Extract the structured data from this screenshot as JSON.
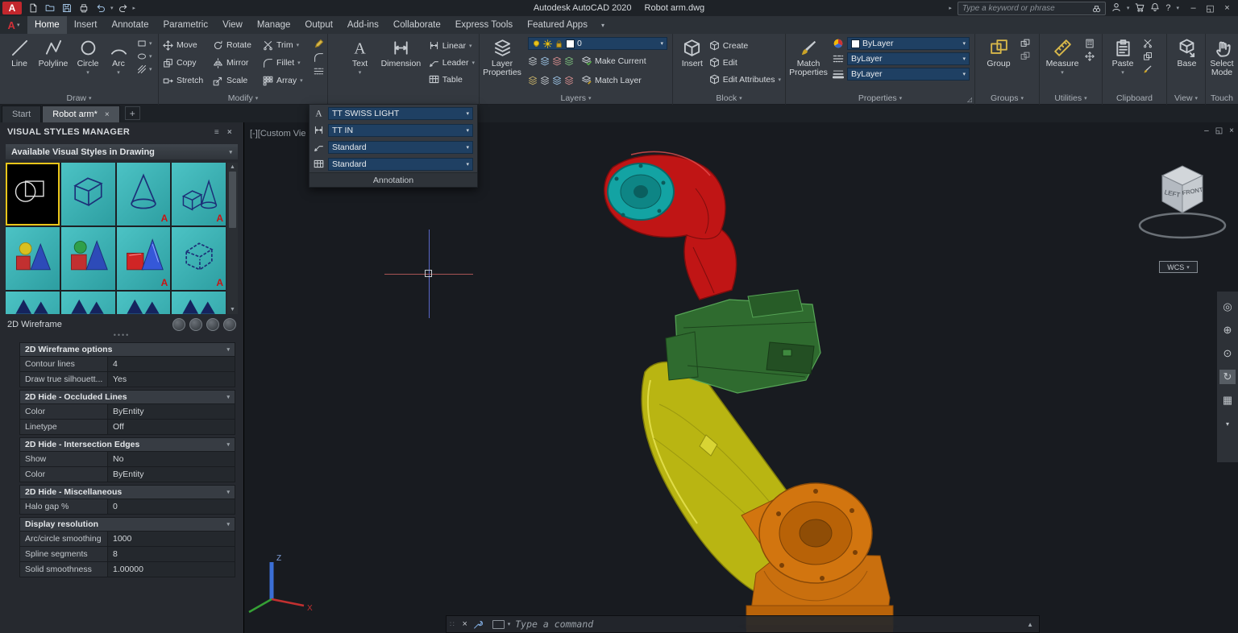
{
  "colors": {
    "accent_red": "#c2272d",
    "selection_yellow": "#e8c51a",
    "combo_blue": "#1f4063",
    "canvas_bg": "#181b20",
    "robot_red": "#c01515",
    "robot_green": "#2f6b2f",
    "robot_yellow": "#b9b512",
    "robot_orange": "#c96f0e",
    "robot_cyan": "#13a3a3"
  },
  "titlebar": {
    "app_title": "Autodesk AutoCAD 2020",
    "doc_title": "Robot arm.dwg",
    "search_placeholder": "Type a keyword or phrase"
  },
  "menu": {
    "active_tab": "Home",
    "tabs": [
      "Home",
      "Insert",
      "Annotate",
      "Parametric",
      "View",
      "Manage",
      "Output",
      "Add-ins",
      "Collaborate",
      "Express Tools",
      "Featured Apps"
    ]
  },
  "ribbon": {
    "draw": {
      "label": "Draw",
      "tools": [
        "Line",
        "Polyline",
        "Circle",
        "Arc"
      ]
    },
    "modify": {
      "label": "Modify",
      "tools": [
        "Move",
        "Rotate",
        "Trim",
        "Copy",
        "Mirror",
        "Fillet",
        "Stretch",
        "Scale",
        "Array"
      ]
    },
    "annotation": {
      "tools": [
        "Text",
        "Dimension",
        "Linear",
        "Leader",
        "Table"
      ]
    },
    "layers": {
      "label": "Layers",
      "big": "Layer Properties",
      "current_layer": "0",
      "make_current": "Make Current",
      "match_layer": "Match Layer"
    },
    "block": {
      "label": "Block",
      "big": "Insert",
      "tools": [
        "Create",
        "Edit",
        "Edit Attributes"
      ]
    },
    "properties": {
      "label": "Properties",
      "big": "Match Properties",
      "object_color": "ByLayer",
      "linetype": "ByLayer",
      "lineweight": "ByLayer"
    },
    "groups": {
      "label": "Groups",
      "big": "Group"
    },
    "utilities": {
      "label": "Utilities",
      "big": "Measure"
    },
    "clipboard": {
      "label": "Clipboard",
      "big": "Paste"
    },
    "view": {
      "label": "View",
      "big": "Base"
    },
    "touch": {
      "label": "Touch",
      "big": "Select Mode"
    }
  },
  "annotation_flyout": {
    "text_style": "TT SWISS LIGHT",
    "dim_style": "TT IN",
    "mleader_style": "Standard",
    "table_style": "Standard",
    "footer": "Annotation"
  },
  "file_tabs": {
    "tabs": [
      "Start",
      "Robot arm*"
    ],
    "active": "Robot arm*"
  },
  "palette": {
    "title": "VISUAL STYLES MANAGER",
    "styles_header": "Available Visual Styles in Drawing",
    "current_style": "2D Wireframe",
    "styles": [
      {
        "kind": "2d-wireframe",
        "selected": true,
        "badge": false
      },
      {
        "kind": "wireframe-box",
        "selected": false,
        "badge": false
      },
      {
        "kind": "hidden-cone",
        "selected": false,
        "badge": true
      },
      {
        "kind": "wireframe-group",
        "selected": false,
        "badge": true
      },
      {
        "kind": "sketchy-solids",
        "selected": false,
        "badge": false
      },
      {
        "kind": "shaded-solids",
        "selected": false,
        "badge": false
      },
      {
        "kind": "realistic-solids",
        "selected": false,
        "badge": true
      },
      {
        "kind": "sketchy-box",
        "selected": false,
        "badge": true
      },
      {
        "kind": "partial",
        "selected": false,
        "badge": false
      },
      {
        "kind": "partial",
        "selected": false,
        "badge": false
      },
      {
        "kind": "partial",
        "selected": false,
        "badge": false
      },
      {
        "kind": "partial",
        "selected": false,
        "badge": false
      }
    ],
    "sections": [
      {
        "title": "2D Wireframe options",
        "rows": [
          {
            "label": "Contour lines",
            "value": "4"
          },
          {
            "label": "Draw true silhouett...",
            "value": "Yes"
          }
        ]
      },
      {
        "title": "2D Hide - Occluded Lines",
        "rows": [
          {
            "label": "Color",
            "value": "ByEntity"
          },
          {
            "label": "Linetype",
            "value": "Off"
          }
        ]
      },
      {
        "title": "2D Hide - Intersection Edges",
        "rows": [
          {
            "label": "Show",
            "value": "No"
          },
          {
            "label": "Color",
            "value": "ByEntity"
          }
        ]
      },
      {
        "title": "2D Hide - Miscellaneous",
        "rows": [
          {
            "label": "Halo gap %",
            "value": "0"
          }
        ]
      },
      {
        "title": "Display resolution",
        "rows": [
          {
            "label": "Arc/circle smoothing",
            "value": "1000"
          },
          {
            "label": "Spline segments",
            "value": "8"
          },
          {
            "label": "Solid smoothness",
            "value": "1.00000"
          }
        ]
      }
    ]
  },
  "canvas": {
    "viewport_label": "[-][Custom Vie",
    "viewcube": {
      "left_face": "LEFT",
      "front_face": "FRONT"
    },
    "wcs_label": "WCS",
    "ucs": {
      "z": "Z",
      "x": "X"
    }
  },
  "command_line": {
    "placeholder": "Type a command"
  }
}
